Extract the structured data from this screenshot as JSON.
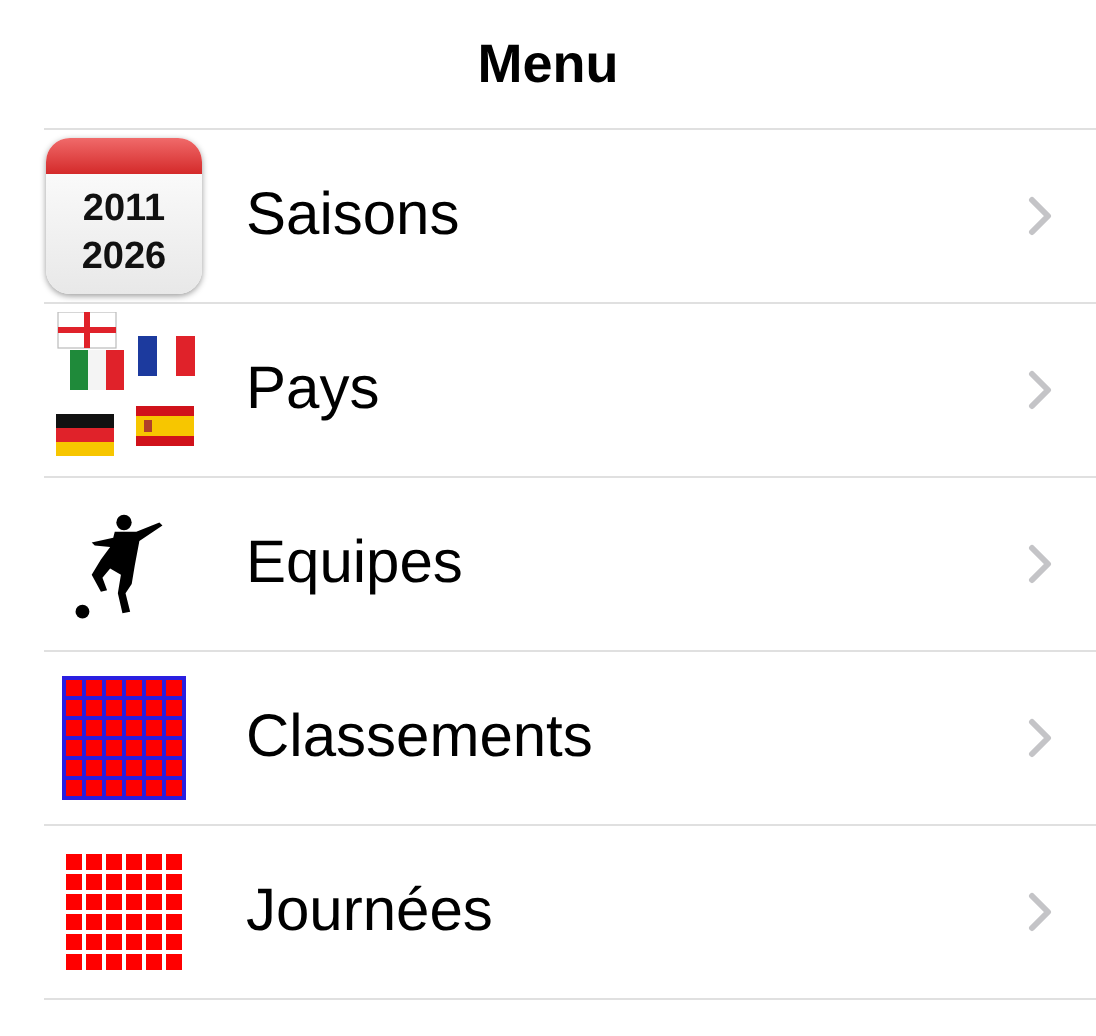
{
  "title": "Menu",
  "items": [
    {
      "label": "Saisons",
      "kind": "calendar",
      "icon_text": [
        "2011",
        "2026"
      ]
    },
    {
      "label": "Pays",
      "kind": "flags"
    },
    {
      "label": "Equipes",
      "kind": "player"
    },
    {
      "label": "Classements",
      "kind": "grid-framed"
    },
    {
      "label": "Journées",
      "kind": "grid"
    }
  ]
}
